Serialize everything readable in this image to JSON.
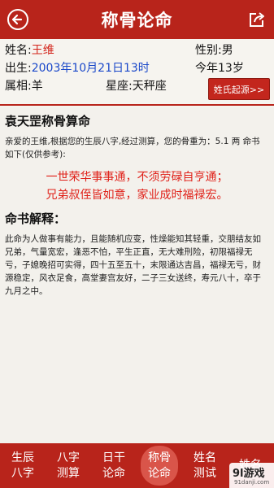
{
  "header": {
    "title": "称骨论命",
    "back_icon": "back-arrow-icon",
    "share_icon": "share-icon"
  },
  "profile": {
    "name_label": "姓名:",
    "name": "王维",
    "gender_label": "性别:",
    "gender": "男",
    "birth_label": "出生:",
    "birth": "2003年10月21日13时",
    "age": "今年13岁",
    "zodiac_label": "属相:",
    "zodiac": "羊",
    "star_label": "星座:",
    "star": "天秤座",
    "origin_button": "姓氏起源>>"
  },
  "reading": {
    "title": "袁天罡称骨算命",
    "intro": "亲爱的王维,根据您的生辰八字,经过测算，您的骨重为：5.1 两 命书如下(仅供参考):",
    "poem_line1": "一世荣华事事通，不须劳碌自亨通；",
    "poem_line2": "兄弟叔侄皆如意，家业成时福禄宏。",
    "explain_title": "命书解释：",
    "explain": "此命为人做事有能力，且能随机应变，性燥能知其轻重，交朋结友如兄弟，气量宽宏，逢恶不怕，平生正直，无大难刑险，初限福禄无亏，子媳晚招可实得，四十五至五十，末限通达吉昌，福禄无亏，财源稳定，风衣足食，高堂妻宫友好，二子三女送终，寿元八十，卒于九月之中。"
  },
  "tabs": [
    {
      "label": "生辰\n八字",
      "active": false
    },
    {
      "label": "八字\n测算",
      "active": false
    },
    {
      "label": "日干\n论命",
      "active": false
    },
    {
      "label": "称骨\n论命",
      "active": true
    },
    {
      "label": "姓名\n测试",
      "active": false
    },
    {
      "label": "姓名\n",
      "active": false
    }
  ],
  "watermark": {
    "brand": "9l游戏",
    "url": "91danji.com"
  },
  "colors": {
    "primary": "#b8241b",
    "accent_blue": "#1947c9",
    "accent_red": "#d3231a"
  }
}
